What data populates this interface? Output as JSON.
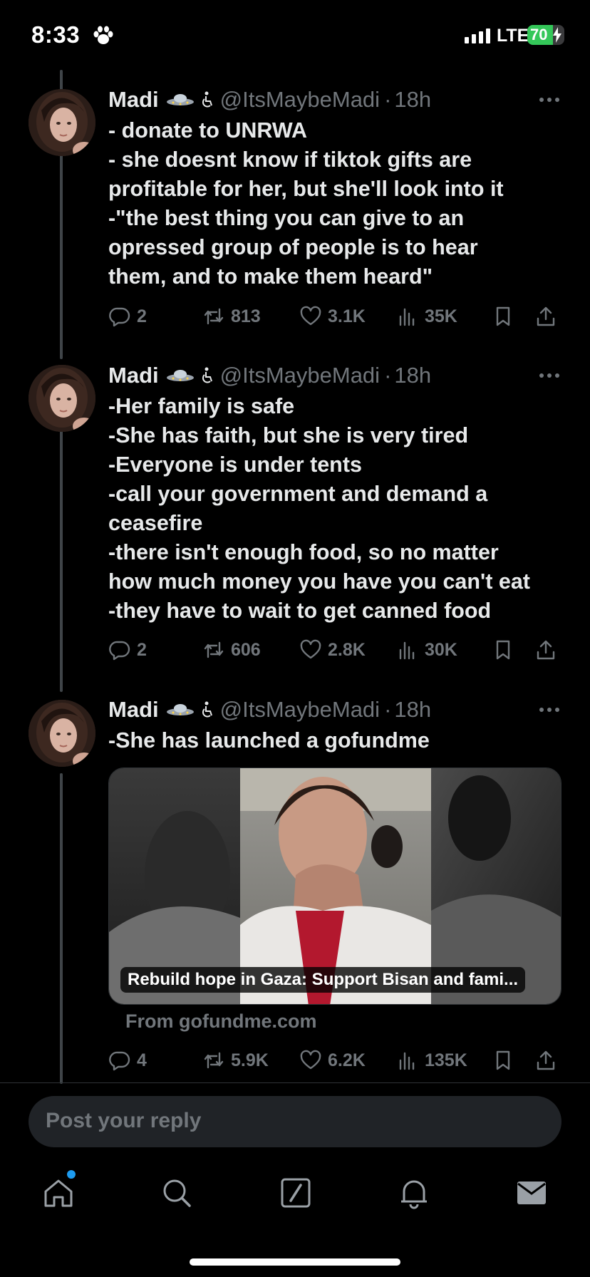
{
  "status_bar": {
    "time": "8:33",
    "network": "LTE",
    "battery_percent": 70,
    "battery_label": "70"
  },
  "tweets": [
    {
      "name": "Madi",
      "handle": "@ItsMaybeMadi",
      "separator": "·",
      "time": "18h",
      "lines": [
        "- donate to UNRWA",
        "- she doesnt know if tiktok gifts are",
        "profitable for her, but she'll look into it",
        "-\"the best thing you can give to an",
        "opressed group of people is to hear",
        "them, and to make them heard\""
      ],
      "stats": {
        "replies": "2",
        "reposts": "813",
        "likes": "3.1K",
        "views": "35K"
      }
    },
    {
      "name": "Madi",
      "handle": "@ItsMaybeMadi",
      "separator": "·",
      "time": "18h",
      "lines": [
        "-Her family is safe",
        "-She has faith, but she is very tired",
        "-Everyone is under tents",
        "-call your government and demand a",
        "ceasefire",
        "-there isn't enough food, so no matter",
        "how much money you have you can't eat",
        "-they have to wait to get canned food"
      ],
      "stats": {
        "replies": "2",
        "reposts": "606",
        "likes": "2.8K",
        "views": "30K"
      }
    },
    {
      "name": "Madi",
      "handle": "@ItsMaybeMadi",
      "separator": "·",
      "time": "18h",
      "lines": [
        "-She has launched a gofundme"
      ],
      "card": {
        "title": "Rebuild hope in Gaza: Support Bisan and fami...",
        "source": "From gofundme.com"
      },
      "stats": {
        "replies": "4",
        "reposts": "5.9K",
        "likes": "6.2K",
        "views": "135K"
      }
    }
  ],
  "reply": {
    "placeholder": "Post your reply"
  },
  "tab_bar": {
    "icons": [
      "home-icon",
      "search-icon",
      "compose-icon",
      "bell-icon",
      "mail-icon"
    ],
    "home_badge_color": "#1d9bf0"
  },
  "colors": {
    "background": "#000000",
    "text": "#e7e9ea",
    "muted": "#71767b",
    "accent": "#1d9bf0"
  }
}
